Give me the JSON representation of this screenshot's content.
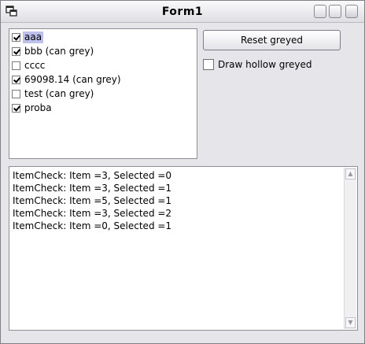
{
  "window": {
    "title": "Form1"
  },
  "checklist": {
    "items": [
      {
        "label": "aaa",
        "checked": true,
        "selected": true
      },
      {
        "label": "bbb (can grey)",
        "checked": true,
        "selected": false
      },
      {
        "label": "cccc",
        "checked": false,
        "selected": false
      },
      {
        "label": "69098.14  (can grey)",
        "checked": true,
        "selected": false
      },
      {
        "label": "test (can grey)",
        "checked": false,
        "selected": false
      },
      {
        "label": "proba",
        "checked": true,
        "selected": false
      }
    ]
  },
  "controls": {
    "reset_label": "Reset greyed",
    "hollow_label": "Draw hollow greyed",
    "hollow_checked": false
  },
  "log": {
    "lines": [
      "ItemCheck: Item =3, Selected =0",
      "ItemCheck: Item =3, Selected =1",
      "ItemCheck: Item =5, Selected =1",
      "ItemCheck: Item =3, Selected =2",
      "ItemCheck: Item =0, Selected =1"
    ]
  },
  "icons": {
    "app": "app-window-icon",
    "minimize": "minimize-icon",
    "maximize": "maximize-icon",
    "close": "close-icon"
  }
}
